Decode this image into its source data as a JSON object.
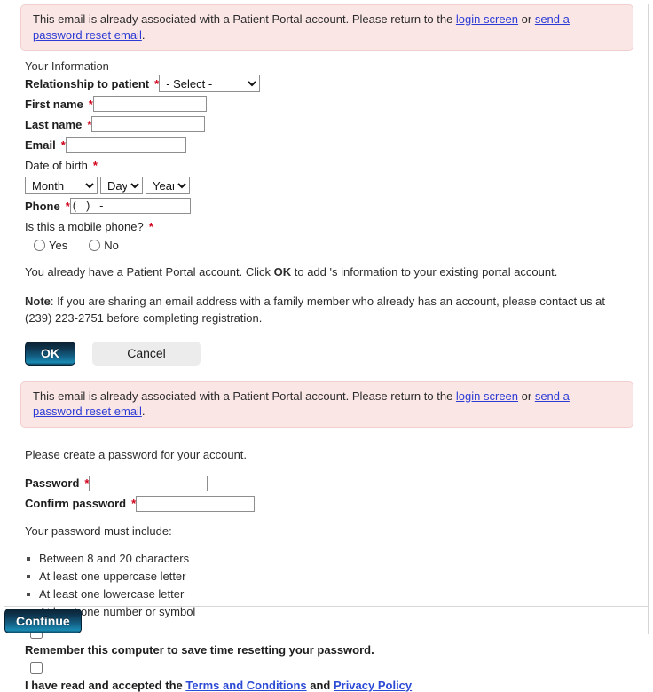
{
  "alert": {
    "text_before": "This email is already associated with a Patient Portal account. Please return to the ",
    "login_link": "login screen",
    "text_middle": " or ",
    "reset_link": "send a password reset email",
    "text_after": ".",
    "background_color": "#fbe6e6",
    "border_color": "#f2cfcf",
    "link_color": "#2b3bd4"
  },
  "your_information": {
    "heading": "Your Information",
    "relationship": {
      "label": "Relationship to patient",
      "required_marker": "*",
      "selected": "- Select -"
    },
    "first_name": {
      "label": "First name",
      "required_marker": "*",
      "value": ""
    },
    "last_name": {
      "label": "Last name",
      "required_marker": "*",
      "value": ""
    },
    "email": {
      "label": "Email",
      "required_marker": "*",
      "value": ""
    },
    "date_of_birth": {
      "label": "Date of birth",
      "required_marker": "*",
      "month": "Month",
      "day": "Day",
      "year": "Year"
    },
    "phone": {
      "label": "Phone",
      "required_marker": "*",
      "value": "(   )   -"
    },
    "mobile_question": {
      "label": "Is this a mobile phone?",
      "required_marker": "*",
      "option_yes": "Yes",
      "option_no": "No",
      "selected": ""
    }
  },
  "messages": {
    "existing_account_before": "You already have a Patient Portal account. Click ",
    "existing_account_bold": "OK",
    "existing_account_after": " to add 's information to your existing portal account.",
    "note_label": "Note",
    "note_text": ": If you are sharing an email address with a family member who already has an account, please contact us at (239) 223-2751 before completing registration."
  },
  "actions": {
    "ok_label": "OK",
    "cancel_label": "Cancel",
    "continue_label": "Continue"
  },
  "password_section": {
    "intro": "Please create a password for your account.",
    "password": {
      "label": "Password",
      "required_marker": "*",
      "value": ""
    },
    "confirm_password": {
      "label": "Confirm password",
      "required_marker": "*",
      "value": ""
    },
    "requirements_heading": "Your password must include:",
    "requirements": [
      "Between 8 and 20 characters",
      "At least one uppercase letter",
      "At least one lowercase letter",
      "At least one number or symbol"
    ]
  },
  "consents": {
    "remember_computer": {
      "label": "Remember this computer to save time resetting your password.",
      "checked": false
    },
    "terms": {
      "text_before": "I have read and accepted the ",
      "terms_link": "Terms and Conditions",
      "text_middle": " and ",
      "privacy_link": "Privacy Policy",
      "checked": false
    }
  }
}
